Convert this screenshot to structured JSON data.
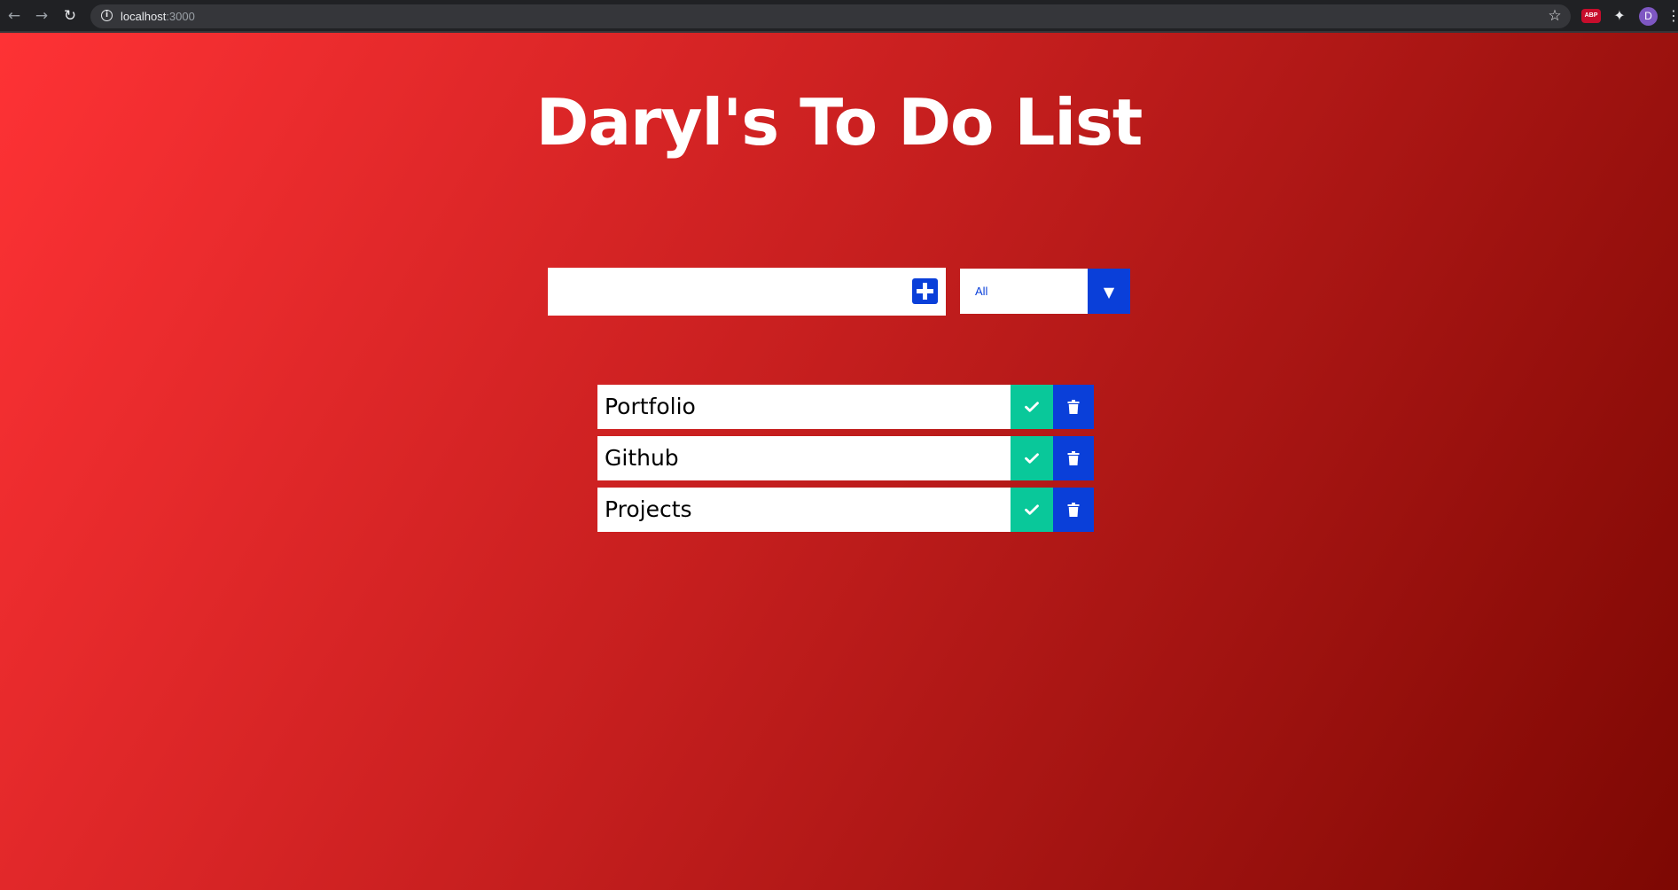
{
  "browser": {
    "url_host": "localhost",
    "url_port": ":3000",
    "avatar_initial": "D",
    "extension_badge": "ABP"
  },
  "page": {
    "title": "Daryl's To Do List"
  },
  "form": {
    "input_value": "",
    "filter_selected": "All"
  },
  "todos": [
    {
      "text": "Portfolio"
    },
    {
      "text": "Github"
    },
    {
      "text": "Projects"
    }
  ],
  "colors": {
    "accent_blue": "#0a3fd9",
    "complete_green": "#09c89a",
    "gradient_start": "#fe3235",
    "gradient_end": "#7d0803"
  },
  "icons": {
    "add": "plus-square-icon",
    "filter": "caret-down-icon",
    "complete": "check-icon",
    "delete": "trash-icon"
  }
}
